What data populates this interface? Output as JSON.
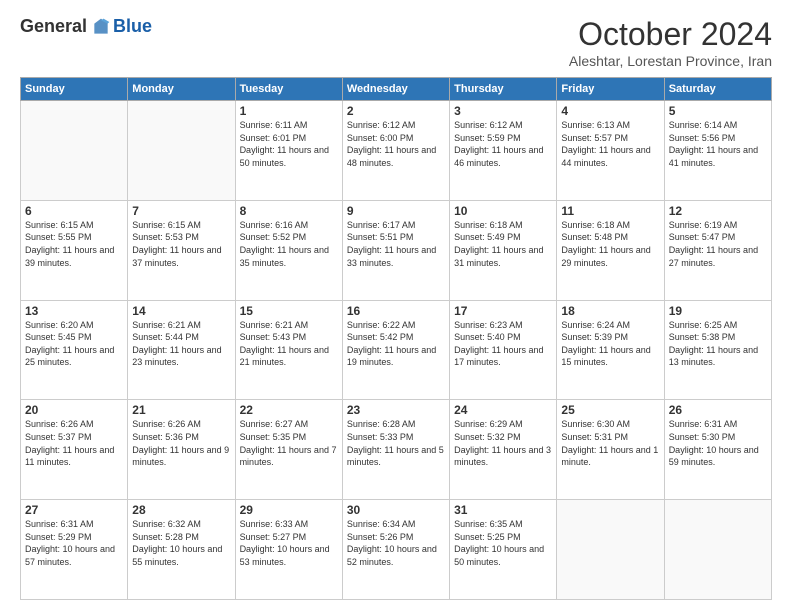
{
  "logo": {
    "general": "General",
    "blue": "Blue"
  },
  "title": "October 2024",
  "subtitle": "Aleshtar, Lorestan Province, Iran",
  "headers": [
    "Sunday",
    "Monday",
    "Tuesday",
    "Wednesday",
    "Thursday",
    "Friday",
    "Saturday"
  ],
  "weeks": [
    [
      {
        "day": "",
        "info": ""
      },
      {
        "day": "",
        "info": ""
      },
      {
        "day": "1",
        "sunrise": "Sunrise: 6:11 AM",
        "sunset": "Sunset: 6:01 PM",
        "daylight": "Daylight: 11 hours and 50 minutes."
      },
      {
        "day": "2",
        "sunrise": "Sunrise: 6:12 AM",
        "sunset": "Sunset: 6:00 PM",
        "daylight": "Daylight: 11 hours and 48 minutes."
      },
      {
        "day": "3",
        "sunrise": "Sunrise: 6:12 AM",
        "sunset": "Sunset: 5:59 PM",
        "daylight": "Daylight: 11 hours and 46 minutes."
      },
      {
        "day": "4",
        "sunrise": "Sunrise: 6:13 AM",
        "sunset": "Sunset: 5:57 PM",
        "daylight": "Daylight: 11 hours and 44 minutes."
      },
      {
        "day": "5",
        "sunrise": "Sunrise: 6:14 AM",
        "sunset": "Sunset: 5:56 PM",
        "daylight": "Daylight: 11 hours and 41 minutes."
      }
    ],
    [
      {
        "day": "6",
        "sunrise": "Sunrise: 6:15 AM",
        "sunset": "Sunset: 5:55 PM",
        "daylight": "Daylight: 11 hours and 39 minutes."
      },
      {
        "day": "7",
        "sunrise": "Sunrise: 6:15 AM",
        "sunset": "Sunset: 5:53 PM",
        "daylight": "Daylight: 11 hours and 37 minutes."
      },
      {
        "day": "8",
        "sunrise": "Sunrise: 6:16 AM",
        "sunset": "Sunset: 5:52 PM",
        "daylight": "Daylight: 11 hours and 35 minutes."
      },
      {
        "day": "9",
        "sunrise": "Sunrise: 6:17 AM",
        "sunset": "Sunset: 5:51 PM",
        "daylight": "Daylight: 11 hours and 33 minutes."
      },
      {
        "day": "10",
        "sunrise": "Sunrise: 6:18 AM",
        "sunset": "Sunset: 5:49 PM",
        "daylight": "Daylight: 11 hours and 31 minutes."
      },
      {
        "day": "11",
        "sunrise": "Sunrise: 6:18 AM",
        "sunset": "Sunset: 5:48 PM",
        "daylight": "Daylight: 11 hours and 29 minutes."
      },
      {
        "day": "12",
        "sunrise": "Sunrise: 6:19 AM",
        "sunset": "Sunset: 5:47 PM",
        "daylight": "Daylight: 11 hours and 27 minutes."
      }
    ],
    [
      {
        "day": "13",
        "sunrise": "Sunrise: 6:20 AM",
        "sunset": "Sunset: 5:45 PM",
        "daylight": "Daylight: 11 hours and 25 minutes."
      },
      {
        "day": "14",
        "sunrise": "Sunrise: 6:21 AM",
        "sunset": "Sunset: 5:44 PM",
        "daylight": "Daylight: 11 hours and 23 minutes."
      },
      {
        "day": "15",
        "sunrise": "Sunrise: 6:21 AM",
        "sunset": "Sunset: 5:43 PM",
        "daylight": "Daylight: 11 hours and 21 minutes."
      },
      {
        "day": "16",
        "sunrise": "Sunrise: 6:22 AM",
        "sunset": "Sunset: 5:42 PM",
        "daylight": "Daylight: 11 hours and 19 minutes."
      },
      {
        "day": "17",
        "sunrise": "Sunrise: 6:23 AM",
        "sunset": "Sunset: 5:40 PM",
        "daylight": "Daylight: 11 hours and 17 minutes."
      },
      {
        "day": "18",
        "sunrise": "Sunrise: 6:24 AM",
        "sunset": "Sunset: 5:39 PM",
        "daylight": "Daylight: 11 hours and 15 minutes."
      },
      {
        "day": "19",
        "sunrise": "Sunrise: 6:25 AM",
        "sunset": "Sunset: 5:38 PM",
        "daylight": "Daylight: 11 hours and 13 minutes."
      }
    ],
    [
      {
        "day": "20",
        "sunrise": "Sunrise: 6:26 AM",
        "sunset": "Sunset: 5:37 PM",
        "daylight": "Daylight: 11 hours and 11 minutes."
      },
      {
        "day": "21",
        "sunrise": "Sunrise: 6:26 AM",
        "sunset": "Sunset: 5:36 PM",
        "daylight": "Daylight: 11 hours and 9 minutes."
      },
      {
        "day": "22",
        "sunrise": "Sunrise: 6:27 AM",
        "sunset": "Sunset: 5:35 PM",
        "daylight": "Daylight: 11 hours and 7 minutes."
      },
      {
        "day": "23",
        "sunrise": "Sunrise: 6:28 AM",
        "sunset": "Sunset: 5:33 PM",
        "daylight": "Daylight: 11 hours and 5 minutes."
      },
      {
        "day": "24",
        "sunrise": "Sunrise: 6:29 AM",
        "sunset": "Sunset: 5:32 PM",
        "daylight": "Daylight: 11 hours and 3 minutes."
      },
      {
        "day": "25",
        "sunrise": "Sunrise: 6:30 AM",
        "sunset": "Sunset: 5:31 PM",
        "daylight": "Daylight: 11 hours and 1 minute."
      },
      {
        "day": "26",
        "sunrise": "Sunrise: 6:31 AM",
        "sunset": "Sunset: 5:30 PM",
        "daylight": "Daylight: 10 hours and 59 minutes."
      }
    ],
    [
      {
        "day": "27",
        "sunrise": "Sunrise: 6:31 AM",
        "sunset": "Sunset: 5:29 PM",
        "daylight": "Daylight: 10 hours and 57 minutes."
      },
      {
        "day": "28",
        "sunrise": "Sunrise: 6:32 AM",
        "sunset": "Sunset: 5:28 PM",
        "daylight": "Daylight: 10 hours and 55 minutes."
      },
      {
        "day": "29",
        "sunrise": "Sunrise: 6:33 AM",
        "sunset": "Sunset: 5:27 PM",
        "daylight": "Daylight: 10 hours and 53 minutes."
      },
      {
        "day": "30",
        "sunrise": "Sunrise: 6:34 AM",
        "sunset": "Sunset: 5:26 PM",
        "daylight": "Daylight: 10 hours and 52 minutes."
      },
      {
        "day": "31",
        "sunrise": "Sunrise: 6:35 AM",
        "sunset": "Sunset: 5:25 PM",
        "daylight": "Daylight: 10 hours and 50 minutes."
      },
      {
        "day": "",
        "info": ""
      },
      {
        "day": "",
        "info": ""
      }
    ]
  ]
}
